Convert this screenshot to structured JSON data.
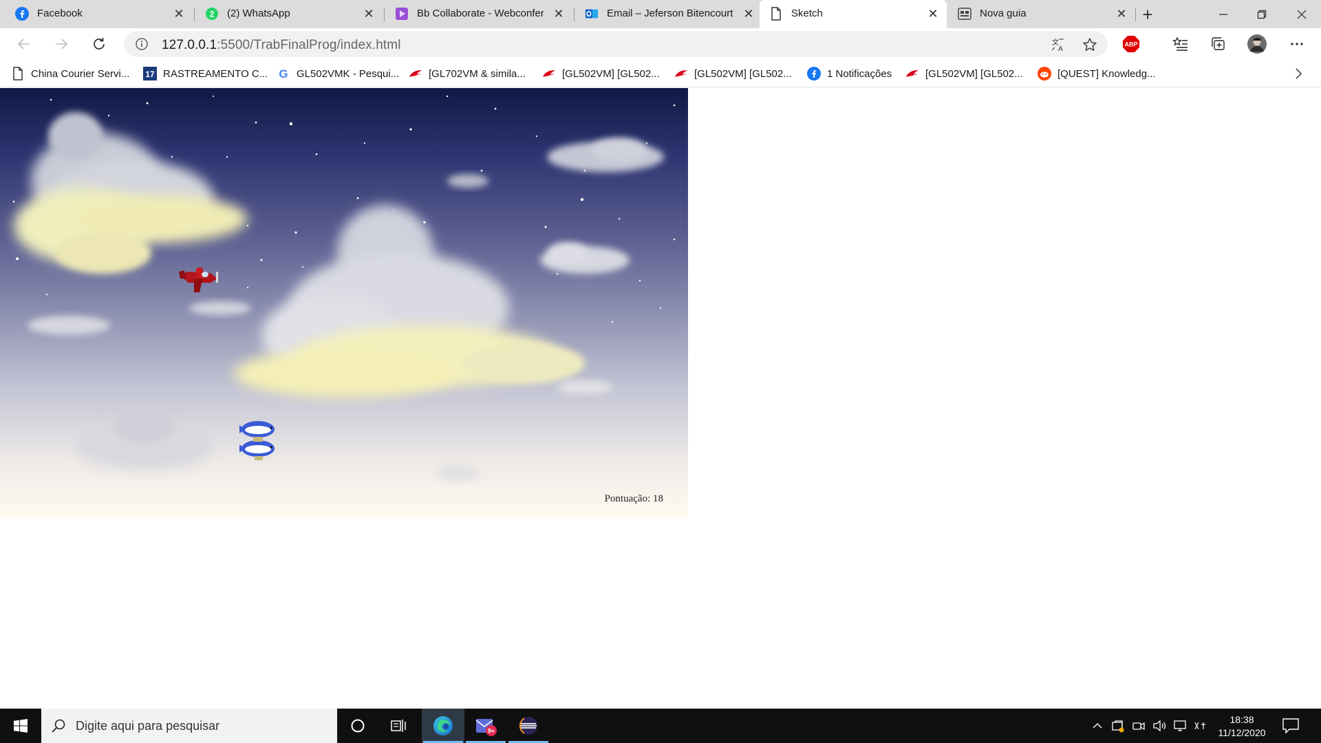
{
  "browser": {
    "tabs": [
      {
        "title": "Facebook",
        "icon": "facebook-icon",
        "active": false
      },
      {
        "title": "(2) WhatsApp",
        "icon": "whatsapp-icon",
        "badge": "2",
        "active": false
      },
      {
        "title": "Bb Collaborate - Webconferê",
        "icon": "collaborate-icon",
        "active": false
      },
      {
        "title": "Email – Jeferson Bitencourt -",
        "icon": "outlook-icon",
        "active": false
      },
      {
        "title": "Sketch",
        "icon": "page-icon",
        "active": true
      },
      {
        "title": "Nova guia",
        "icon": "newtab-page-icon",
        "active": false
      }
    ],
    "address": {
      "host": "127.0.0.1",
      "rest": ":5500/TrabFinalProg/index.html"
    },
    "extension_label": "ABP",
    "bookmarks": [
      {
        "label": "China Courier Servi...",
        "icon": "page-icon"
      },
      {
        "label": "RASTREAMENTO C...",
        "icon": "17track-icon",
        "icon_text": "17"
      },
      {
        "label": "GL502VMK - Pesqui...",
        "icon": "google-icon",
        "icon_text": "G"
      },
      {
        "label": "[GL702VM & simila...",
        "icon": "rog-icon"
      },
      {
        "label": "[GL502VM] [GL502...",
        "icon": "rog-icon"
      },
      {
        "label": "[GL502VM] [GL502...",
        "icon": "rog-icon"
      },
      {
        "label": "1 Notificações",
        "icon": "facebook-icon"
      },
      {
        "label": "[GL502VM] [GL502...",
        "icon": "rog-icon"
      },
      {
        "label": "[QUEST] Knowledg...",
        "icon": "reddit-icon"
      }
    ],
    "colors": {
      "tabstrip": "#dcdcdc",
      "accent": "#0078d4"
    }
  },
  "game": {
    "score_text": "Pontuação: 18",
    "score": 18,
    "sprites": [
      "red-plane",
      "blue-fish-blimp"
    ]
  },
  "taskbar": {
    "search_placeholder": "Digite aqui para pesquisar",
    "mail_badge": "9+",
    "time": "18:38",
    "date": "11/12/2020"
  }
}
